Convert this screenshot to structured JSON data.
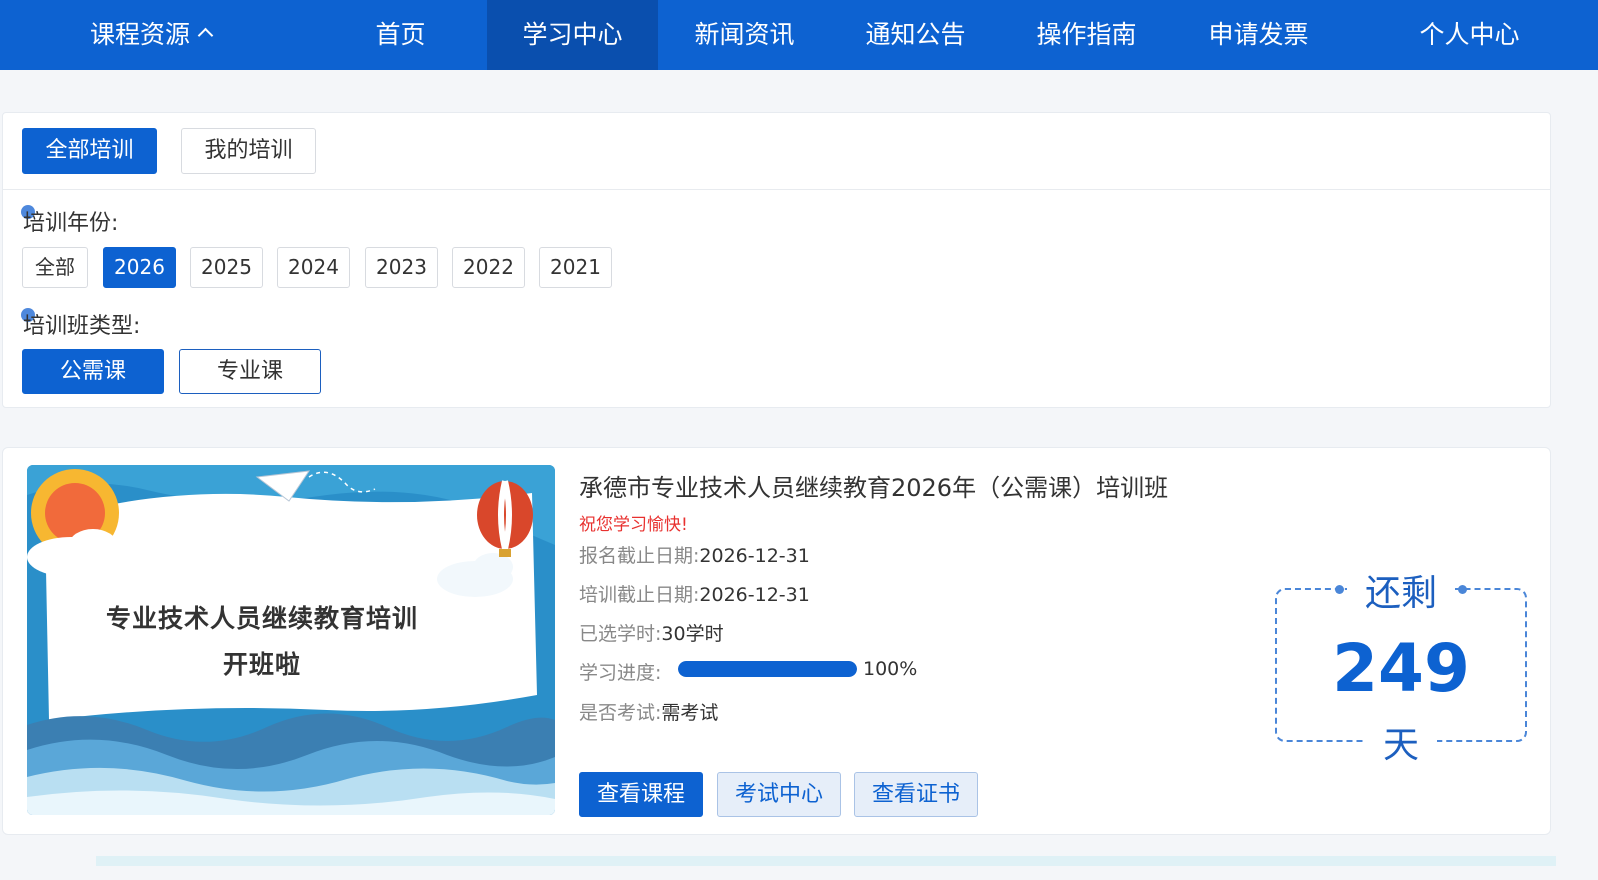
{
  "nav": {
    "course_resources": "课程资源",
    "items": [
      "首页",
      "学习中心",
      "新闻资讯",
      "通知公告",
      "操作指南",
      "申请发票",
      "个人中心"
    ],
    "active": "学习中心"
  },
  "filter": {
    "tabs": [
      "全部培训",
      "我的培训"
    ],
    "year_label": "培训年份:",
    "years": [
      "全部",
      "2026",
      "2025",
      "2024",
      "2023",
      "2022",
      "2021"
    ],
    "selected_year": "2026",
    "type_label": "培训班类型:",
    "types": [
      "公需课",
      "专业课"
    ],
    "selected_type": "公需课"
  },
  "course": {
    "banner_line1": "专业技术人员继续教育培训",
    "banner_line2": "开班啦",
    "title": "承德市专业技术人员继续教育2026年（公需课）培训班",
    "greeting": "祝您学习愉快!",
    "reg_deadline_label": "报名截止日期:",
    "reg_deadline": "2026-12-31",
    "train_deadline_label": "培训截止日期:",
    "train_deadline": "2026-12-31",
    "hours_label": "已选学时:",
    "hours": "30学时",
    "progress_label": "学习进度:",
    "progress_text": "100%",
    "progress_value": 1.0,
    "exam_label": "是否考试:",
    "exam": "需考试",
    "buttons": [
      "查看课程",
      "考试中心",
      "查看证书"
    ]
  },
  "countdown": {
    "top": "还剩",
    "days": "249",
    "unit": "天"
  },
  "colors": {
    "primary": "#0d62d1",
    "accent_red": "#e8312f"
  }
}
